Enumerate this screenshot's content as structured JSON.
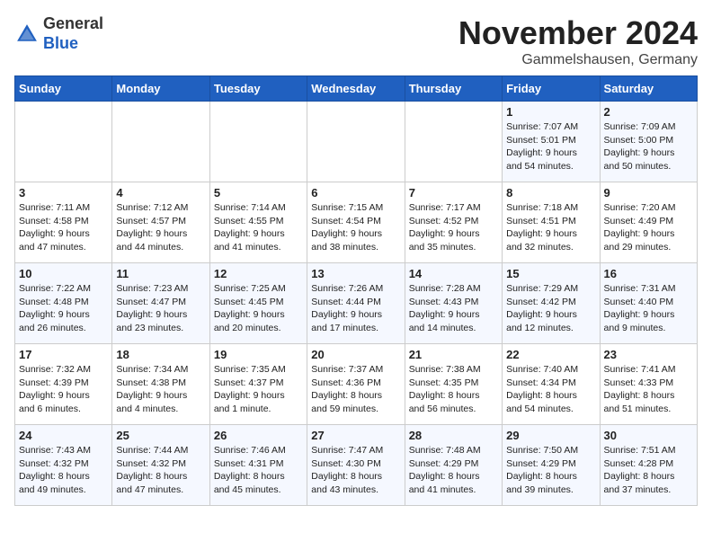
{
  "header": {
    "logo_line1": "General",
    "logo_line2": "Blue",
    "month_title": "November 2024",
    "location": "Gammelshausen, Germany"
  },
  "weekdays": [
    "Sunday",
    "Monday",
    "Tuesday",
    "Wednesday",
    "Thursday",
    "Friday",
    "Saturday"
  ],
  "weeks": [
    [
      {
        "day": "",
        "info": ""
      },
      {
        "day": "",
        "info": ""
      },
      {
        "day": "",
        "info": ""
      },
      {
        "day": "",
        "info": ""
      },
      {
        "day": "",
        "info": ""
      },
      {
        "day": "1",
        "info": "Sunrise: 7:07 AM\nSunset: 5:01 PM\nDaylight: 9 hours\nand 54 minutes."
      },
      {
        "day": "2",
        "info": "Sunrise: 7:09 AM\nSunset: 5:00 PM\nDaylight: 9 hours\nand 50 minutes."
      }
    ],
    [
      {
        "day": "3",
        "info": "Sunrise: 7:11 AM\nSunset: 4:58 PM\nDaylight: 9 hours\nand 47 minutes."
      },
      {
        "day": "4",
        "info": "Sunrise: 7:12 AM\nSunset: 4:57 PM\nDaylight: 9 hours\nand 44 minutes."
      },
      {
        "day": "5",
        "info": "Sunrise: 7:14 AM\nSunset: 4:55 PM\nDaylight: 9 hours\nand 41 minutes."
      },
      {
        "day": "6",
        "info": "Sunrise: 7:15 AM\nSunset: 4:54 PM\nDaylight: 9 hours\nand 38 minutes."
      },
      {
        "day": "7",
        "info": "Sunrise: 7:17 AM\nSunset: 4:52 PM\nDaylight: 9 hours\nand 35 minutes."
      },
      {
        "day": "8",
        "info": "Sunrise: 7:18 AM\nSunset: 4:51 PM\nDaylight: 9 hours\nand 32 minutes."
      },
      {
        "day": "9",
        "info": "Sunrise: 7:20 AM\nSunset: 4:49 PM\nDaylight: 9 hours\nand 29 minutes."
      }
    ],
    [
      {
        "day": "10",
        "info": "Sunrise: 7:22 AM\nSunset: 4:48 PM\nDaylight: 9 hours\nand 26 minutes."
      },
      {
        "day": "11",
        "info": "Sunrise: 7:23 AM\nSunset: 4:47 PM\nDaylight: 9 hours\nand 23 minutes."
      },
      {
        "day": "12",
        "info": "Sunrise: 7:25 AM\nSunset: 4:45 PM\nDaylight: 9 hours\nand 20 minutes."
      },
      {
        "day": "13",
        "info": "Sunrise: 7:26 AM\nSunset: 4:44 PM\nDaylight: 9 hours\nand 17 minutes."
      },
      {
        "day": "14",
        "info": "Sunrise: 7:28 AM\nSunset: 4:43 PM\nDaylight: 9 hours\nand 14 minutes."
      },
      {
        "day": "15",
        "info": "Sunrise: 7:29 AM\nSunset: 4:42 PM\nDaylight: 9 hours\nand 12 minutes."
      },
      {
        "day": "16",
        "info": "Sunrise: 7:31 AM\nSunset: 4:40 PM\nDaylight: 9 hours\nand 9 minutes."
      }
    ],
    [
      {
        "day": "17",
        "info": "Sunrise: 7:32 AM\nSunset: 4:39 PM\nDaylight: 9 hours\nand 6 minutes."
      },
      {
        "day": "18",
        "info": "Sunrise: 7:34 AM\nSunset: 4:38 PM\nDaylight: 9 hours\nand 4 minutes."
      },
      {
        "day": "19",
        "info": "Sunrise: 7:35 AM\nSunset: 4:37 PM\nDaylight: 9 hours\nand 1 minute."
      },
      {
        "day": "20",
        "info": "Sunrise: 7:37 AM\nSunset: 4:36 PM\nDaylight: 8 hours\nand 59 minutes."
      },
      {
        "day": "21",
        "info": "Sunrise: 7:38 AM\nSunset: 4:35 PM\nDaylight: 8 hours\nand 56 minutes."
      },
      {
        "day": "22",
        "info": "Sunrise: 7:40 AM\nSunset: 4:34 PM\nDaylight: 8 hours\nand 54 minutes."
      },
      {
        "day": "23",
        "info": "Sunrise: 7:41 AM\nSunset: 4:33 PM\nDaylight: 8 hours\nand 51 minutes."
      }
    ],
    [
      {
        "day": "24",
        "info": "Sunrise: 7:43 AM\nSunset: 4:32 PM\nDaylight: 8 hours\nand 49 minutes."
      },
      {
        "day": "25",
        "info": "Sunrise: 7:44 AM\nSunset: 4:32 PM\nDaylight: 8 hours\nand 47 minutes."
      },
      {
        "day": "26",
        "info": "Sunrise: 7:46 AM\nSunset: 4:31 PM\nDaylight: 8 hours\nand 45 minutes."
      },
      {
        "day": "27",
        "info": "Sunrise: 7:47 AM\nSunset: 4:30 PM\nDaylight: 8 hours\nand 43 minutes."
      },
      {
        "day": "28",
        "info": "Sunrise: 7:48 AM\nSunset: 4:29 PM\nDaylight: 8 hours\nand 41 minutes."
      },
      {
        "day": "29",
        "info": "Sunrise: 7:50 AM\nSunset: 4:29 PM\nDaylight: 8 hours\nand 39 minutes."
      },
      {
        "day": "30",
        "info": "Sunrise: 7:51 AM\nSunset: 4:28 PM\nDaylight: 8 hours\nand 37 minutes."
      }
    ]
  ]
}
